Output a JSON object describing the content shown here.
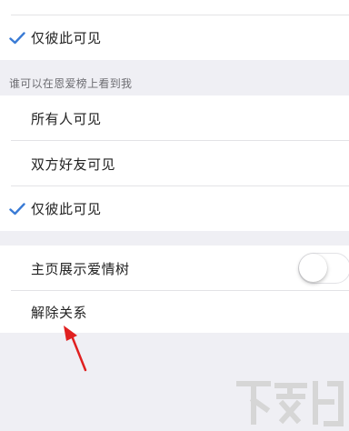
{
  "colors": {
    "background": "#efeff4",
    "cell": "#ffffff",
    "check": "#3a7bd5",
    "annotation_arrow": "#e02020",
    "watermark": "#d6d6d6"
  },
  "top_group": {
    "items": [
      {
        "label": "仅彼此可见",
        "checked": true,
        "check_icon": "checkmark-icon"
      }
    ]
  },
  "wishlist_section": {
    "header": "谁可以在恩爱榜上看到我",
    "items": [
      {
        "label": "所有人可见",
        "checked": false
      },
      {
        "label": "双方好友可见",
        "checked": false
      },
      {
        "label": "仅彼此可见",
        "checked": true,
        "check_icon": "checkmark-icon"
      }
    ]
  },
  "settings_group": {
    "items": [
      {
        "label": "主页展示爱情树",
        "toggle": false
      },
      {
        "label": "解除关系"
      }
    ]
  },
  "annotation": {
    "icon": "red-arrow-icon"
  },
  "watermark": {
    "icon": "xiazaiba-logo"
  }
}
